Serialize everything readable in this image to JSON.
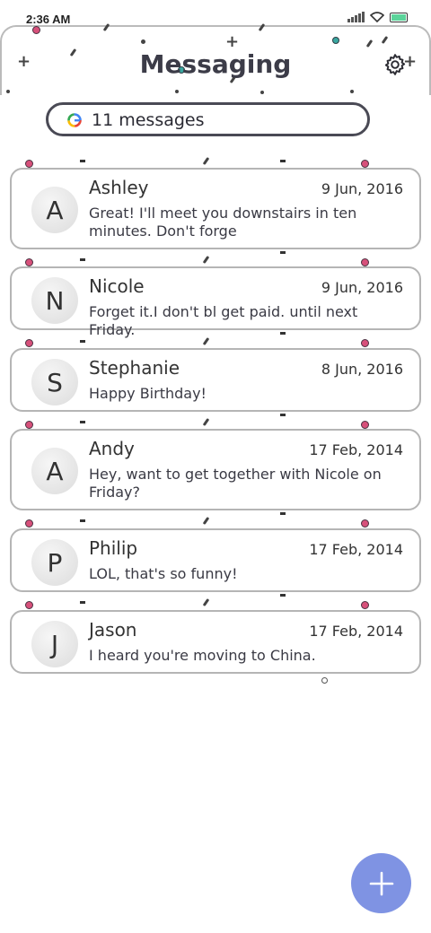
{
  "status_bar": {
    "time": "2:36 AM",
    "icons": [
      "signal-icon",
      "wifi-icon",
      "battery-icon"
    ]
  },
  "header": {
    "title": "Messaging",
    "settings_icon": "gear-icon"
  },
  "search": {
    "count_label": "11 messages",
    "icon": "google-icon"
  },
  "messages": [
    {
      "initial": "A",
      "name": "Ashley",
      "date": "9 Jun, 2016",
      "preview": "Great! I'll meet you downstairs in ten minutes. Don't forge"
    },
    {
      "initial": "N",
      "name": "Nicole",
      "date": "9 Jun, 2016",
      "preview": "Forget it.I don't bl get paid. until next Friday."
    },
    {
      "initial": "S",
      "name": "Stephanie",
      "date": "8 Jun, 2016",
      "preview": "Happy Birthday!"
    },
    {
      "initial": "A",
      "name": "Andy",
      "date": "17 Feb, 2014",
      "preview": "Hey, want to get together with Nicole on Friday?"
    },
    {
      "initial": "P",
      "name": "Philip",
      "date": "17 Feb, 2014",
      "preview": "LOL, that's so funny!"
    },
    {
      "initial": "J",
      "name": "Jason",
      "date": "17 Feb, 2014",
      "preview": "I heard you're moving to China."
    }
  ],
  "fab": {
    "icon": "plus-icon"
  },
  "colors": {
    "fab": "#7f93e3",
    "border": "#b5b5b5",
    "title": "#3c3c48",
    "battery": "#5bd49a"
  }
}
